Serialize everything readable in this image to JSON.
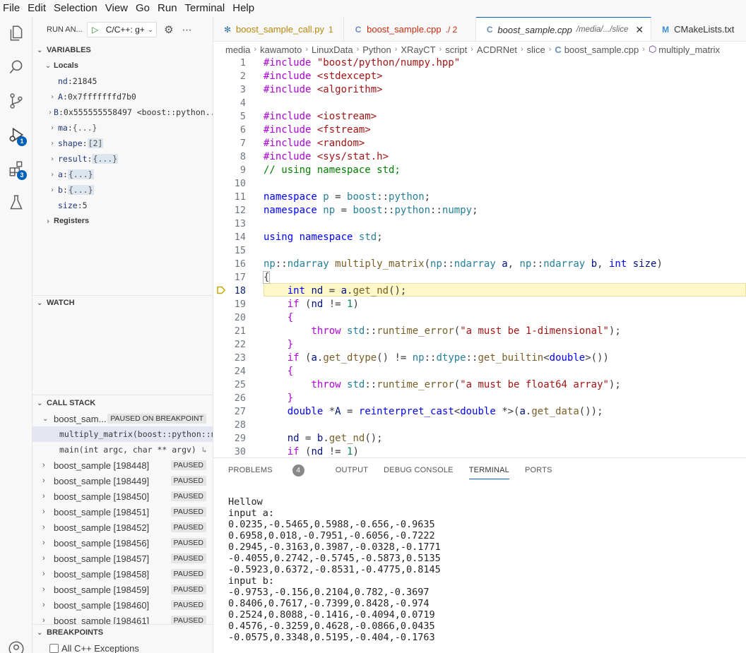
{
  "menu": [
    "File",
    "Edit",
    "Selection",
    "View",
    "Go",
    "Run",
    "Terminal",
    "Help"
  ],
  "activity": {
    "debug_badge": "1",
    "extensions_badge": "3"
  },
  "run": {
    "title": "RUN AN...",
    "config": "C/C++: g+"
  },
  "variables": {
    "header": "VARIABLES",
    "locals_label": "Locals",
    "items": [
      {
        "name": "nd",
        "value": "21845",
        "expandable": false
      },
      {
        "name": "A",
        "value": "0x7fffffffd7b0",
        "expandable": true
      },
      {
        "name": "B",
        "value": "0x555555558497 <boost::python...",
        "expandable": true
      },
      {
        "name": "ma",
        "value": "{...}",
        "expandable": true
      },
      {
        "name": "shape",
        "value": "[2]",
        "expandable": true
      },
      {
        "name": "result",
        "value": "{...}",
        "expandable": true
      },
      {
        "name": "a",
        "value": "{...}",
        "expandable": true
      },
      {
        "name": "b",
        "value": "{...}",
        "expandable": true
      },
      {
        "name": "size",
        "value": "5",
        "expandable": false
      }
    ],
    "registers_label": "Registers"
  },
  "watch": {
    "header": "WATCH"
  },
  "callstack": {
    "header": "CALL STACK",
    "main_thread": {
      "label": "boost_sam...",
      "status": "PAUSED ON BREAKPOINT"
    },
    "frames": [
      "multiply_matrix(boost::python::num",
      "main(int argc, char ** argv)"
    ],
    "threads": [
      {
        "label": "boost_sample [198448]",
        "status": "PAUSED"
      },
      {
        "label": "boost_sample [198449]",
        "status": "PAUSED"
      },
      {
        "label": "boost_sample [198450]",
        "status": "PAUSED"
      },
      {
        "label": "boost_sample [198451]",
        "status": "PAUSED"
      },
      {
        "label": "boost_sample [198452]",
        "status": "PAUSED"
      },
      {
        "label": "boost_sample [198456]",
        "status": "PAUSED"
      },
      {
        "label": "boost_sample [198457]",
        "status": "PAUSED"
      },
      {
        "label": "boost_sample [198458]",
        "status": "PAUSED"
      },
      {
        "label": "boost_sample [198459]",
        "status": "PAUSED"
      },
      {
        "label": "boost_sample [198460]",
        "status": "PAUSED"
      },
      {
        "label": "boost_sample [198461]",
        "status": "PAUSED"
      }
    ]
  },
  "breakpoints": {
    "header": "BREAKPOINTS",
    "item": "All C++ Exceptions"
  },
  "tabs": [
    {
      "label": "boost_sample_call.py",
      "suffix": "1",
      "icon": "python-icon"
    },
    {
      "label": "boost_sample.cpp",
      "suffix": "./ 2",
      "icon": "cpp-icon"
    },
    {
      "label": "boost_sample.cpp",
      "suffix": "/media/.../slice",
      "icon": "cpp-icon"
    },
    {
      "label": "CMakeLists.txt",
      "suffix": "",
      "icon": "cmake-icon"
    }
  ],
  "breadcrumb": [
    "media",
    "kawamoto",
    "LinuxData",
    "Python",
    "XRayCT",
    "script",
    "ACDRNet",
    "slice",
    "boost_sample.cpp",
    "multiply_matrix"
  ],
  "editor": {
    "current_line": 18,
    "line_numbers": [
      "1",
      "2",
      "3",
      "4",
      "5",
      "6",
      "7",
      "8",
      "9",
      "10",
      "11",
      "12",
      "13",
      "14",
      "15",
      "16",
      "17",
      "18",
      "19",
      "20",
      "21",
      "22",
      "23",
      "24",
      "25",
      "26",
      "27",
      "28",
      "29",
      "30"
    ]
  },
  "panel": {
    "tabs": [
      "PROBLEMS",
      "OUTPUT",
      "DEBUG CONSOLE",
      "TERMINAL",
      "PORTS"
    ],
    "problems_count": "4",
    "active_tab": "TERMINAL",
    "terminal_lines": [
      "Hellow",
      "input a:",
      "0.0235,-0.5465,0.5988,-0.656,-0.9635",
      "0.6958,0.018,-0.7951,-0.6056,-0.7222",
      "0.2945,-0.3163,0.3987,-0.0328,-0.1771",
      "-0.4055,0.2742,-0.5745,-0.5873,0.5135",
      "-0.5923,0.6372,-0.8531,-0.4775,0.8145",
      "input b:",
      "-0.9753,-0.156,0.2104,0.782,-0.3697",
      "0.8406,0.7617,-0.7399,0.8428,-0.974",
      "0.2524,0.8088,-0.1416,-0.4094,0.0719",
      "0.4576,-0.3259,0.4628,-0.0866,0.0435",
      "-0.0575,0.3348,0.5195,-0.404,-0.1763"
    ]
  }
}
